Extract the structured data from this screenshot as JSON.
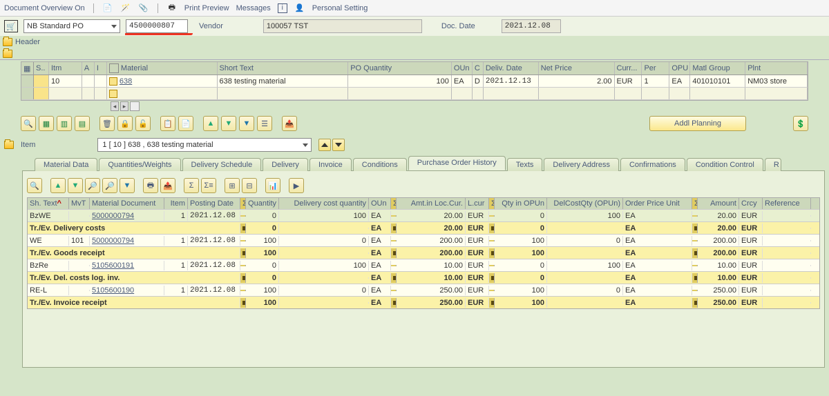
{
  "menu": {
    "overview": "Document Overview On",
    "print_preview": "Print Preview",
    "messages": "Messages",
    "personal_setting": "Personal Setting"
  },
  "header": {
    "po_type": "NB Standard PO",
    "po_number": "4500000807",
    "vendor_label": "Vendor",
    "vendor_value": "100057 TST",
    "doc_date_label": "Doc. Date",
    "doc_date": "2021.12.08",
    "header_label": "Header"
  },
  "items": {
    "cols": {
      "s": "S..",
      "itm": "Itm",
      "a": "A",
      "i": "I",
      "mat": "Material",
      "short": "Short Text",
      "qty": "PO Quantity",
      "oun": "OUn",
      "c": "C",
      "deliv": "Deliv. Date",
      "price": "Net Price",
      "curr": "Curr...",
      "per": "Per",
      "opu": "OPU",
      "mg": "Matl Group",
      "plnt": "Plnt"
    },
    "rows": [
      {
        "itm": "10",
        "mat": "638",
        "short": "638 testing material",
        "qty": "100",
        "oun": "EA",
        "c": "D",
        "deliv": "2021.12.13",
        "price": "2.00",
        "curr": "EUR",
        "per": "1",
        "opu": "EA",
        "mg": "401010101",
        "plnt": "NM03 store"
      }
    ]
  },
  "mid_toolbar": {
    "addl_planning": "Addl Planning"
  },
  "item_detail": {
    "label": "Item",
    "selected": "1 [ 10 ] 638 , 638 testing material"
  },
  "tabs": [
    "Material Data",
    "Quantities/Weights",
    "Delivery Schedule",
    "Delivery",
    "Invoice",
    "Conditions",
    "Purchase Order History",
    "Texts",
    "Delivery Address",
    "Confirmations",
    "Condition Control"
  ],
  "active_tab": 6,
  "history": {
    "cols": {
      "sh": "Sh. Text",
      "mvt": "MvT",
      "mdoc": "Material Document",
      "item": "Item",
      "pd": "Posting Date",
      "qty": "Quantity",
      "dcq": "Delivery cost quantity",
      "oun": "OUn",
      "amt": "Amt.in Loc.Cur.",
      "lcur": "L.cur",
      "qou": "Qty in OPUn",
      "dcqo": "DelCostQty (OPUn)",
      "opu": "Order Price Unit",
      "amount": "Amount",
      "crcy": "Crcy",
      "ref": "Reference"
    },
    "rows": [
      {
        "type": "data",
        "cls": "g",
        "sh": "BzWE",
        "mvt": "",
        "mdoc": "5000000794",
        "item": "1",
        "pd": "2021.12.08",
        "qty": "0",
        "dcq": "100",
        "oun": "EA",
        "amt": "20.00",
        "lcur": "EUR",
        "qou": "0",
        "dcqo": "100",
        "opu": "EA",
        "amount": "20.00",
        "crcy": "EUR"
      },
      {
        "type": "sub",
        "cls": "y",
        "label": "Tr./Ev. Delivery costs",
        "qty": "0",
        "dcq": "",
        "oun": "EA",
        "amt": "20.00",
        "lcur": "EUR",
        "qou": "0",
        "dcqo": "",
        "opu": "EA",
        "amount": "20.00",
        "crcy": "EUR"
      },
      {
        "type": "data",
        "cls": "w",
        "sh": "WE",
        "mvt": "101",
        "mdoc": "5000000794",
        "item": "1",
        "pd": "2021.12.08",
        "qty": "100",
        "dcq": "0",
        "oun": "EA",
        "amt": "200.00",
        "lcur": "EUR",
        "qou": "100",
        "dcqo": "0",
        "opu": "EA",
        "amount": "200.00",
        "crcy": "EUR"
      },
      {
        "type": "sub",
        "cls": "y",
        "label": "Tr./Ev. Goods receipt",
        "qty": "100",
        "dcq": "",
        "oun": "EA",
        "amt": "200.00",
        "lcur": "EUR",
        "qou": "100",
        "dcqo": "",
        "opu": "EA",
        "amount": "200.00",
        "crcy": "EUR"
      },
      {
        "type": "data",
        "cls": "w",
        "sh": "BzRe",
        "mvt": "",
        "mdoc": "5105600191",
        "item": "1",
        "pd": "2021.12.08",
        "qty": "0",
        "dcq": "100",
        "oun": "EA",
        "amt": "10.00",
        "lcur": "EUR",
        "qou": "0",
        "dcqo": "100",
        "opu": "EA",
        "amount": "10.00",
        "crcy": "EUR"
      },
      {
        "type": "sub",
        "cls": "y",
        "label": "Tr./Ev. Del. costs log. inv.",
        "qty": "0",
        "dcq": "",
        "oun": "EA",
        "amt": "10.00",
        "lcur": "EUR",
        "qou": "0",
        "dcqo": "",
        "opu": "EA",
        "amount": "10.00",
        "crcy": "EUR"
      },
      {
        "type": "data",
        "cls": "w",
        "sh": "RE-L",
        "mvt": "",
        "mdoc": "5105600190",
        "item": "1",
        "pd": "2021.12.08",
        "qty": "100",
        "dcq": "0",
        "oun": "EA",
        "amt": "250.00",
        "lcur": "EUR",
        "qou": "100",
        "dcqo": "0",
        "opu": "EA",
        "amount": "250.00",
        "crcy": "EUR"
      },
      {
        "type": "sub",
        "cls": "y",
        "label": "Tr./Ev. Invoice receipt",
        "qty": "100",
        "dcq": "",
        "oun": "EA",
        "amt": "250.00",
        "lcur": "EUR",
        "qou": "100",
        "dcqo": "",
        "opu": "EA",
        "amount": "250.00",
        "crcy": "EUR"
      }
    ]
  }
}
